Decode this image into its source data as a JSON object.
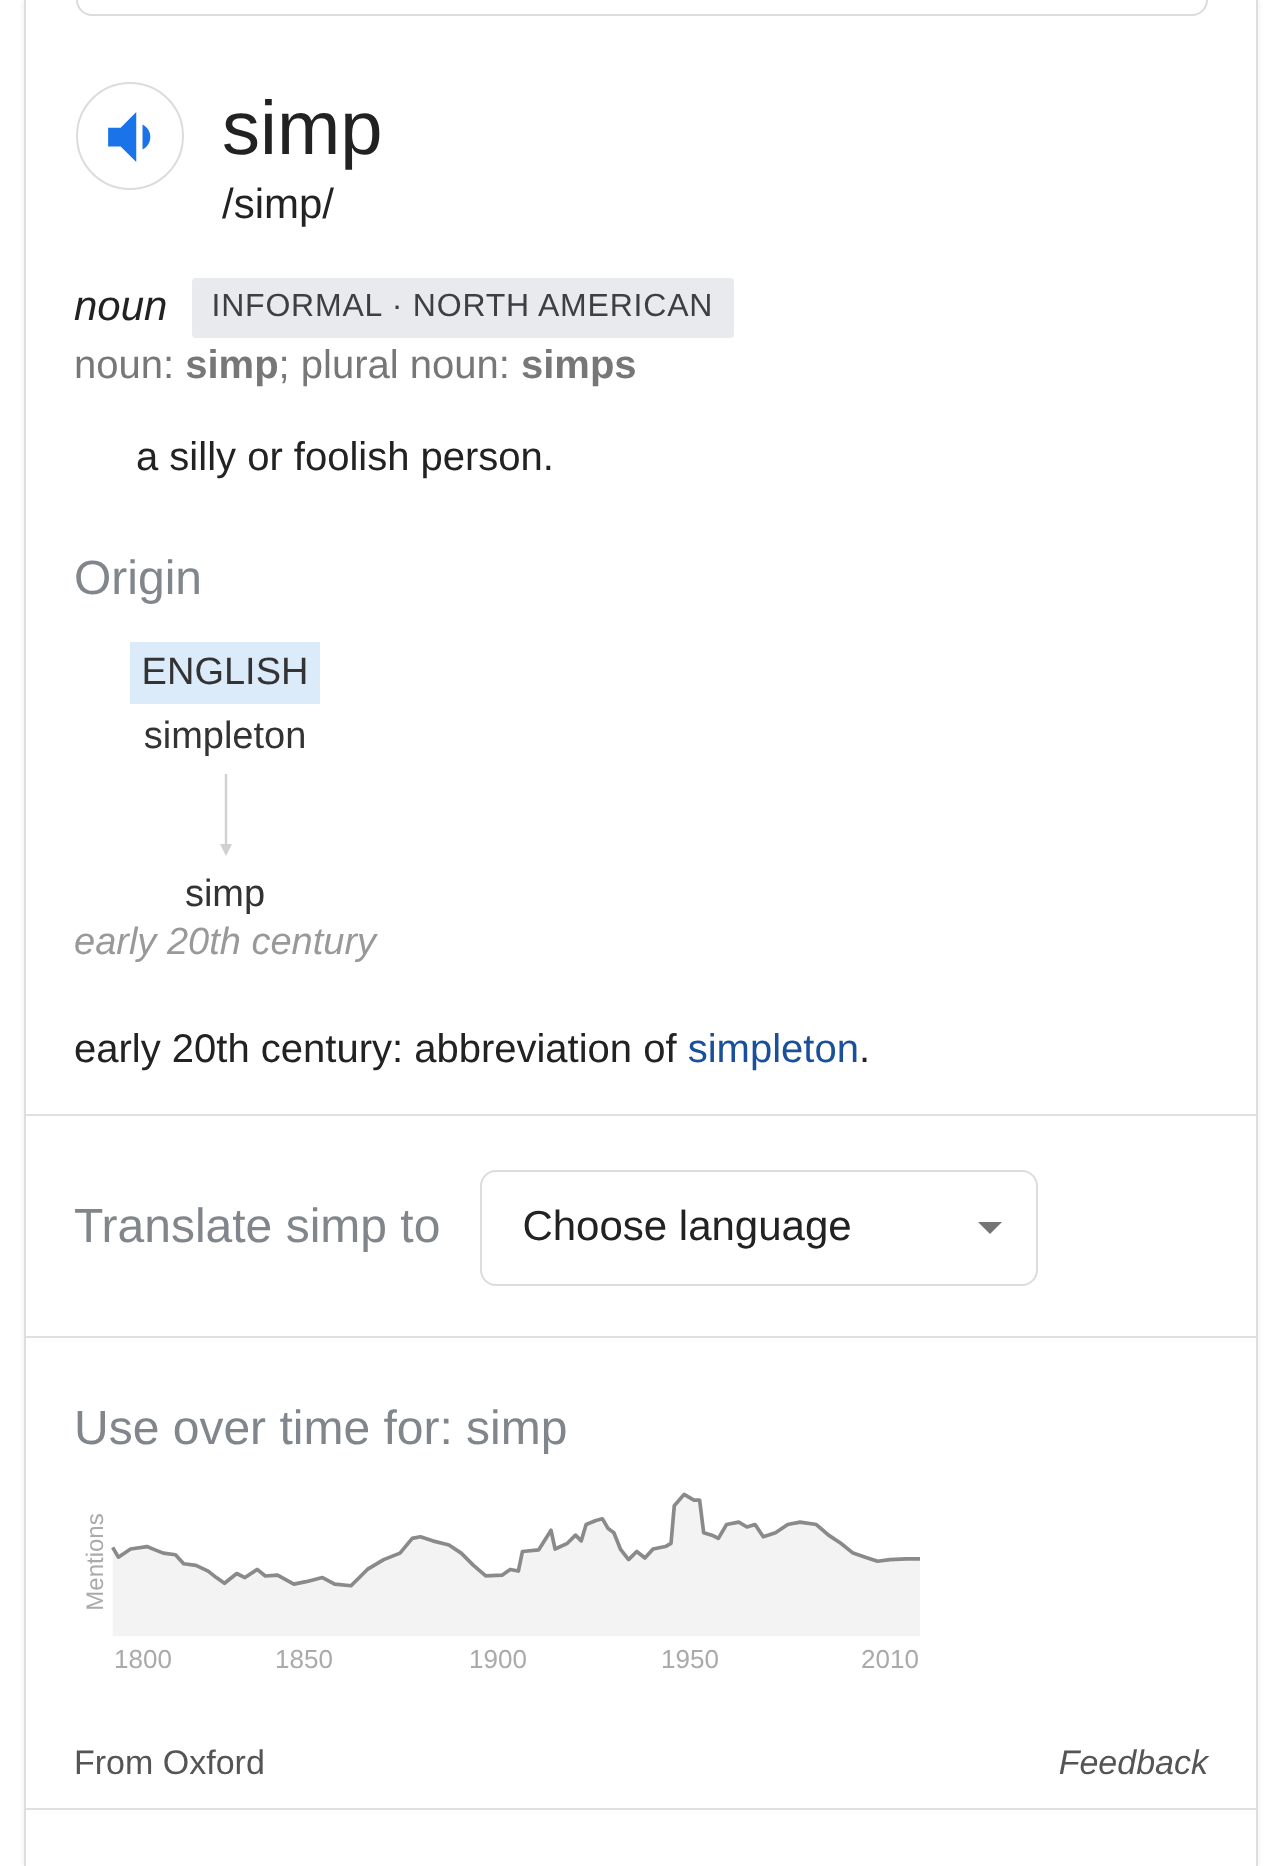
{
  "entry": {
    "headword": "simp",
    "pronunciation": "/simp/",
    "part_of_speech": "noun",
    "register_label": "INFORMAL · NORTH AMERICAN",
    "forms": "noun: **simp**; plural noun: **simps**",
    "definitions": [
      "a silly or foolish person."
    ]
  },
  "origin": {
    "title": "Origin",
    "tree": [
      {
        "kind": "language",
        "text": "ENGLISH"
      },
      {
        "kind": "word",
        "text": "simpleton"
      },
      {
        "kind": "arrow"
      },
      {
        "kind": "word",
        "text": "simp"
      },
      {
        "kind": "date",
        "text": "early 20th century"
      }
    ],
    "note": {
      "text": "early 20th century: abbreviation of ",
      "link": "simpleton",
      "end": "."
    }
  },
  "translate": {
    "label": "Translate simp to",
    "dropdown": {
      "label": "Choose language"
    }
  },
  "usage": {
    "title": "Use over time for: simp",
    "y_axis_label": "Mentions",
    "x_axis_labels": [
      "1800",
      "1850",
      "1900",
      "1950",
      "2010"
    ]
  },
  "footer": {
    "source": "From Oxford",
    "feedback": "Feedback"
  }
}
